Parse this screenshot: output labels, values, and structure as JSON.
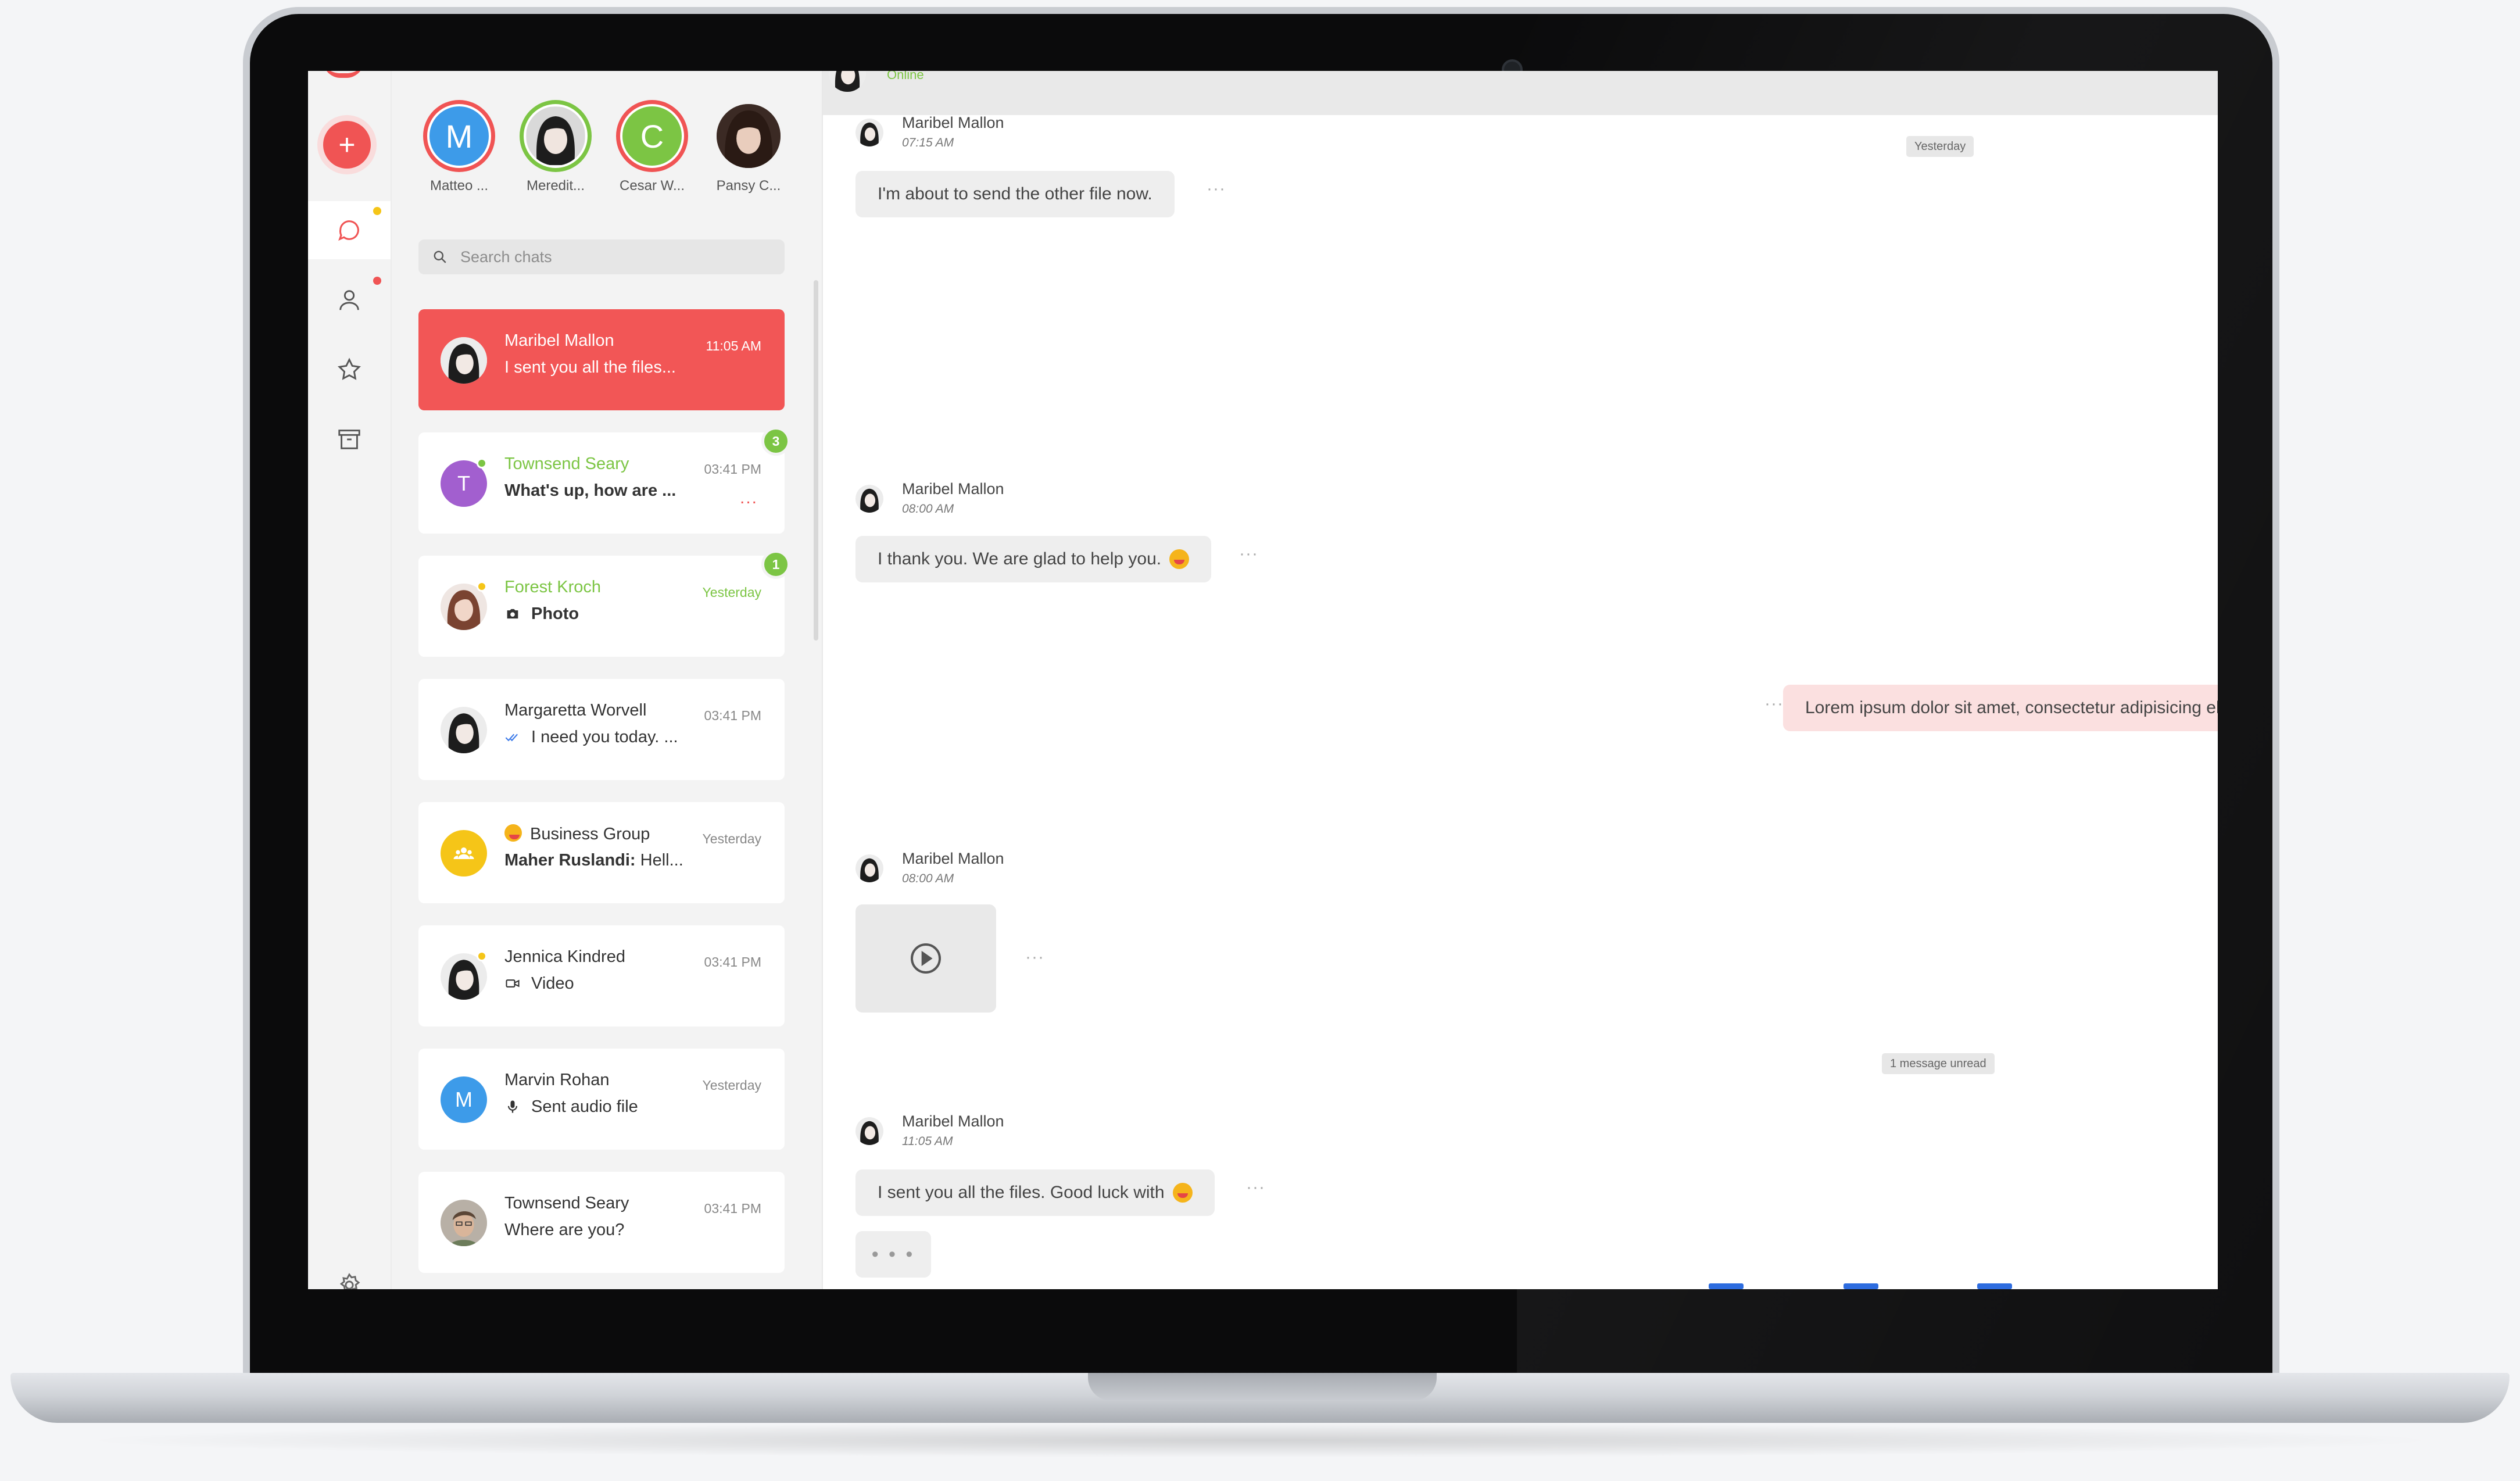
{
  "stories": [
    {
      "initial": "M",
      "name": "Matteo ...",
      "ring": "#f05454",
      "bg": "#3d9be9"
    },
    {
      "initial": "",
      "name": "Meredit...",
      "ring": "#7cc544",
      "bg": "#e5e5e5"
    },
    {
      "initial": "C",
      "name": "Cesar W...",
      "ring": "#f05454",
      "bg": "#7cc544"
    },
    {
      "initial": "",
      "name": "Pansy C...",
      "ring": "#f3f3f3",
      "bg": "#6b4b3e"
    }
  ],
  "search": {
    "placeholder": "Search chats"
  },
  "chats": [
    {
      "name": "Maribel Mallon",
      "preview": "I sent you all the files...",
      "time": "11:05 AM"
    },
    {
      "name": "Townsend Seary",
      "initial": "T",
      "preview": "What's up, how are ...",
      "time": "03:41 PM",
      "badge": "3",
      "typing": "..."
    },
    {
      "name": "Forest Kroch",
      "preview": "Photo",
      "time": "Yesterday",
      "badge": "1"
    },
    {
      "name": "Margaretta Worvell",
      "preview": "I need you today. ...",
      "time": "03:41 PM"
    },
    {
      "name": "Business Group",
      "preview_sender": "Maher Ruslandi:",
      "preview": " Hell...",
      "time": "Yesterday"
    },
    {
      "name": "Jennica Kindred",
      "preview": "Video",
      "time": "03:41 PM"
    },
    {
      "name": "Marvin Rohan",
      "initial": "M",
      "preview": "Sent audio file",
      "time": "Yesterday"
    },
    {
      "name": "Townsend Seary",
      "preview": "Where are you?",
      "time": "03:41 PM"
    }
  ],
  "conversation": {
    "header_status": "Online",
    "messages": [
      {
        "sender": "Maribel Mallon",
        "time": "07:15 AM",
        "text": "I'm about to send the other file now."
      },
      {
        "sender": "Maribel Mallon",
        "time": "08:00 AM",
        "text": "I thank you. We are glad to help you."
      },
      {
        "outgoing_text": "Lorem ipsum dolor sit amet, consectetur adipisicing el"
      },
      {
        "sender": "Maribel Mallon",
        "time": "08:00 AM",
        "type": "video"
      },
      {
        "sender": "Maribel Mallon",
        "time": "11:05 AM",
        "text": "I sent you all the files. Good luck with"
      }
    ],
    "date_separator": "Yesterday",
    "unread_separator": "1 message unread",
    "more_label": "···",
    "typing_label": "• • •"
  },
  "colors": {
    "accent": "#f05454",
    "online_green": "#7cc544",
    "outgoing_bubble": "#fbe0e0",
    "incoming_bubble": "#eeeeee"
  },
  "icons": {
    "new_chat": "plus-icon",
    "rail": [
      "chat-bubble-icon",
      "user-icon",
      "star-icon",
      "archive-icon",
      "gear-icon"
    ],
    "search": "search-icon",
    "play": "play-circle-icon"
  },
  "glyphs": {
    "plus": "+"
  }
}
